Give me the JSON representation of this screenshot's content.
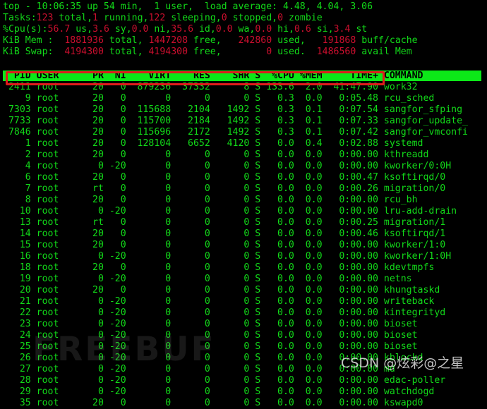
{
  "terminal": {
    "app": "top",
    "colors": {
      "background": "#000000",
      "text_green": "#12d919",
      "number_red": "#cc0f2e",
      "header_bar_green": "#0ce818",
      "header_bar_text": "#000000",
      "annotation_red": "#e01b1b"
    }
  },
  "summary": {
    "uptime_line": {
      "prefix": "top - ",
      "time": "10:06:35",
      "up_label": " up ",
      "uptime": "54 min,",
      "users": "  1 user,",
      "load_label": "  load average: ",
      "load_avg": "4.48, 4.04, 3.06",
      "full": "top - 10:06:35 up 54 min,  1 user,  load average: 4.48, 4.04, 3.06"
    },
    "tasks": {
      "label": "Tasks:",
      "total": "123",
      "total_label": " total,",
      "running": "1",
      "running_label": " running,",
      "sleeping": "122",
      "sleeping_label": " sleeping,",
      "stopped": "0",
      "stopped_label": " stopped,",
      "zombie": "0",
      "zombie_label": " zombie"
    },
    "cpu": {
      "label": "%Cpu(s):",
      "us": "56.7",
      "us_label": " us,",
      "sy": "3.6",
      "sy_label": " sy,",
      "ni": "0.0",
      "ni_label": " ni,",
      "id": "35.6",
      "id_label": " id,",
      "wa": "0.0",
      "wa_label": " wa,",
      "hi": "0.0",
      "hi_label": " hi,",
      "si": "0.6",
      "si_label": " si,",
      "st": "3.4",
      "st_label": " st"
    },
    "mem": {
      "label": "KiB Mem :",
      "total": "1881936",
      "total_label": " total,",
      "free": "1447208",
      "free_label": " free,",
      "used": "242860",
      "used_label": " used,",
      "buffcache": "191868",
      "buffcache_label": " buff/cache"
    },
    "swap": {
      "label": "KiB Swap:",
      "total": "4194300",
      "total_label": " total,",
      "free": "4194300",
      "free_label": " free,",
      "used": "0",
      "used_label": " used.",
      "avail": "1486560",
      "avail_label": " avail Mem"
    }
  },
  "table": {
    "header_text": "  PID USER      PR  NI    VIRT    RES    SHR S  %CPU %MEM     TIME+ COMMAND",
    "columns": [
      "PID",
      "USER",
      "PR",
      "NI",
      "VIRT",
      "RES",
      "SHR",
      "S",
      "%CPU",
      "%MEM",
      "TIME+",
      "COMMAND"
    ],
    "rows": [
      {
        "line": " 2411 root      20   0  879236  37332      8 S 133.6  2.0  41:47.90 work32",
        "pid": "2411",
        "user": "root",
        "pr": "20",
        "ni": "0",
        "virt": "879236",
        "res": "37332",
        "shr": "8",
        "s": "S",
        "cpu": "133.6",
        "mem": "2.0",
        "time": "41:47.90",
        "command": "work32"
      },
      {
        "line": "    9 root      20   0       0      0      0 S   0.3  0.0   0:05.48 rcu_sched",
        "pid": "9",
        "user": "root",
        "pr": "20",
        "ni": "0",
        "virt": "0",
        "res": "0",
        "shr": "0",
        "s": "S",
        "cpu": "0.3",
        "mem": "0.0",
        "time": "0:05.48",
        "command": "rcu_sched"
      },
      {
        "line": " 7303 root      20   0  115688   2104   1492 S   0.3  0.1   0:07.54 sangfor_sfping",
        "pid": "7303",
        "user": "root",
        "pr": "20",
        "ni": "0",
        "virt": "115688",
        "res": "2104",
        "shr": "1492",
        "s": "S",
        "cpu": "0.3",
        "mem": "0.1",
        "time": "0:07.54",
        "command": "sangfor_sfping"
      },
      {
        "line": " 7733 root      20   0  115700   2184   1492 S   0.3  0.1   0:07.33 sangfor_update_",
        "pid": "7733",
        "user": "root",
        "pr": "20",
        "ni": "0",
        "virt": "115700",
        "res": "2184",
        "shr": "1492",
        "s": "S",
        "cpu": "0.3",
        "mem": "0.1",
        "time": "0:07.33",
        "command": "sangfor_update_"
      },
      {
        "line": " 7846 root      20   0  115696   2172   1492 S   0.3  0.1   0:07.42 sangfor_vmconfi",
        "pid": "7846",
        "user": "root",
        "pr": "20",
        "ni": "0",
        "virt": "115696",
        "res": "2172",
        "shr": "1492",
        "s": "S",
        "cpu": "0.3",
        "mem": "0.1",
        "time": "0:07.42",
        "command": "sangfor_vmconfi"
      },
      {
        "line": "    1 root      20   0  128104   6652   4120 S   0.0  0.4   0:02.88 systemd",
        "pid": "1",
        "user": "root",
        "pr": "20",
        "ni": "0",
        "virt": "128104",
        "res": "6652",
        "shr": "4120",
        "s": "S",
        "cpu": "0.0",
        "mem": "0.4",
        "time": "0:02.88",
        "command": "systemd"
      },
      {
        "line": "    2 root      20   0       0      0      0 S   0.0  0.0   0:00.00 kthreadd",
        "pid": "2",
        "user": "root",
        "pr": "20",
        "ni": "0",
        "virt": "0",
        "res": "0",
        "shr": "0",
        "s": "S",
        "cpu": "0.0",
        "mem": "0.0",
        "time": "0:00.00",
        "command": "kthreadd"
      },
      {
        "line": "    4 root       0 -20       0      0      0 S   0.0  0.0   0:00.00 kworker/0:0H",
        "pid": "4",
        "user": "root",
        "pr": "0",
        "ni": "-20",
        "virt": "0",
        "res": "0",
        "shr": "0",
        "s": "S",
        "cpu": "0.0",
        "mem": "0.0",
        "time": "0:00.00",
        "command": "kworker/0:0H"
      },
      {
        "line": "    6 root      20   0       0      0      0 S   0.0  0.0   0:00.47 ksoftirqd/0",
        "pid": "6",
        "user": "root",
        "pr": "20",
        "ni": "0",
        "virt": "0",
        "res": "0",
        "shr": "0",
        "s": "S",
        "cpu": "0.0",
        "mem": "0.0",
        "time": "0:00.47",
        "command": "ksoftirqd/0"
      },
      {
        "line": "    7 root      rt   0       0      0      0 S   0.0  0.0   0:00.26 migration/0",
        "pid": "7",
        "user": "root",
        "pr": "rt",
        "ni": "0",
        "virt": "0",
        "res": "0",
        "shr": "0",
        "s": "S",
        "cpu": "0.0",
        "mem": "0.0",
        "time": "0:00.26",
        "command": "migration/0"
      },
      {
        "line": "    8 root      20   0       0      0      0 S   0.0  0.0   0:00.00 rcu_bh",
        "pid": "8",
        "user": "root",
        "pr": "20",
        "ni": "0",
        "virt": "0",
        "res": "0",
        "shr": "0",
        "s": "S",
        "cpu": "0.0",
        "mem": "0.0",
        "time": "0:00.00",
        "command": "rcu_bh"
      },
      {
        "line": "   10 root       0 -20       0      0      0 S   0.0  0.0   0:00.00 lru-add-drain",
        "pid": "10",
        "user": "root",
        "pr": "0",
        "ni": "-20",
        "virt": "0",
        "res": "0",
        "shr": "0",
        "s": "S",
        "cpu": "0.0",
        "mem": "0.0",
        "time": "0:00.00",
        "command": "lru-add-drain"
      },
      {
        "line": "   13 root      rt   0       0      0      0 S   0.0  0.0   0:00.25 migration/1",
        "pid": "13",
        "user": "root",
        "pr": "rt",
        "ni": "0",
        "virt": "0",
        "res": "0",
        "shr": "0",
        "s": "S",
        "cpu": "0.0",
        "mem": "0.0",
        "time": "0:00.25",
        "command": "migration/1"
      },
      {
        "line": "   14 root      20   0       0      0      0 S   0.0  0.0   0:00.46 ksoftirqd/1",
        "pid": "14",
        "user": "root",
        "pr": "20",
        "ni": "0",
        "virt": "0",
        "res": "0",
        "shr": "0",
        "s": "S",
        "cpu": "0.0",
        "mem": "0.0",
        "time": "0:00.46",
        "command": "ksoftirqd/1"
      },
      {
        "line": "   15 root      20   0       0      0      0 S   0.0  0.0   0:00.00 kworker/1:0",
        "pid": "15",
        "user": "root",
        "pr": "20",
        "ni": "0",
        "virt": "0",
        "res": "0",
        "shr": "0",
        "s": "S",
        "cpu": "0.0",
        "mem": "0.0",
        "time": "0:00.00",
        "command": "kworker/1:0"
      },
      {
        "line": "   16 root       0 -20       0      0      0 S   0.0  0.0   0:00.00 kworker/1:0H",
        "pid": "16",
        "user": "root",
        "pr": "0",
        "ni": "-20",
        "virt": "0",
        "res": "0",
        "shr": "0",
        "s": "S",
        "cpu": "0.0",
        "mem": "0.0",
        "time": "0:00.00",
        "command": "kworker/1:0H"
      },
      {
        "line": "   18 root      20   0       0      0      0 S   0.0  0.0   0:00.00 kdevtmpfs",
        "pid": "18",
        "user": "root",
        "pr": "20",
        "ni": "0",
        "virt": "0",
        "res": "0",
        "shr": "0",
        "s": "S",
        "cpu": "0.0",
        "mem": "0.0",
        "time": "0:00.00",
        "command": "kdevtmpfs"
      },
      {
        "line": "   19 root       0 -20       0      0      0 S   0.0  0.0   0:00.00 netns",
        "pid": "19",
        "user": "root",
        "pr": "0",
        "ni": "-20",
        "virt": "0",
        "res": "0",
        "shr": "0",
        "s": "S",
        "cpu": "0.0",
        "mem": "0.0",
        "time": "0:00.00",
        "command": "netns"
      },
      {
        "line": "   20 root      20   0       0      0      0 S   0.0  0.0   0:00.00 khungtaskd",
        "pid": "20",
        "user": "root",
        "pr": "20",
        "ni": "0",
        "virt": "0",
        "res": "0",
        "shr": "0",
        "s": "S",
        "cpu": "0.0",
        "mem": "0.0",
        "time": "0:00.00",
        "command": "khungtaskd"
      },
      {
        "line": "   21 root       0 -20       0      0      0 S   0.0  0.0   0:00.00 writeback",
        "pid": "21",
        "user": "root",
        "pr": "0",
        "ni": "-20",
        "virt": "0",
        "res": "0",
        "shr": "0",
        "s": "S",
        "cpu": "0.0",
        "mem": "0.0",
        "time": "0:00.00",
        "command": "writeback"
      },
      {
        "line": "   22 root       0 -20       0      0      0 S   0.0  0.0   0:00.00 kintegrityd",
        "pid": "22",
        "user": "root",
        "pr": "0",
        "ni": "-20",
        "virt": "0",
        "res": "0",
        "shr": "0",
        "s": "S",
        "cpu": "0.0",
        "mem": "0.0",
        "time": "0:00.00",
        "command": "kintegrityd"
      },
      {
        "line": "   23 root       0 -20       0      0      0 S   0.0  0.0   0:00.00 bioset",
        "pid": "23",
        "user": "root",
        "pr": "0",
        "ni": "-20",
        "virt": "0",
        "res": "0",
        "shr": "0",
        "s": "S",
        "cpu": "0.0",
        "mem": "0.0",
        "time": "0:00.00",
        "command": "bioset"
      },
      {
        "line": "   24 root       0 -20       0      0      0 S   0.0  0.0   0:00.00 bioset",
        "pid": "24",
        "user": "root",
        "pr": "0",
        "ni": "-20",
        "virt": "0",
        "res": "0",
        "shr": "0",
        "s": "S",
        "cpu": "0.0",
        "mem": "0.0",
        "time": "0:00.00",
        "command": "bioset"
      },
      {
        "line": "   25 root       0 -20       0      0      0 S   0.0  0.0   0:00.00 bioset",
        "pid": "25",
        "user": "root",
        "pr": "0",
        "ni": "-20",
        "virt": "0",
        "res": "0",
        "shr": "0",
        "s": "S",
        "cpu": "0.0",
        "mem": "0.0",
        "time": "0:00.00",
        "command": "bioset"
      },
      {
        "line": "   26 root       0 -20       0      0      0 S   0.0  0.0   0:00.00 kblockd",
        "pid": "26",
        "user": "root",
        "pr": "0",
        "ni": "-20",
        "virt": "0",
        "res": "0",
        "shr": "0",
        "s": "S",
        "cpu": "0.0",
        "mem": "0.0",
        "time": "0:00.00",
        "command": "kblockd"
      },
      {
        "line": "   27 root       0 -20       0      0      0 S   0.0  0.0   0:00.00 md",
        "pid": "27",
        "user": "root",
        "pr": "0",
        "ni": "-20",
        "virt": "0",
        "res": "0",
        "shr": "0",
        "s": "S",
        "cpu": "0.0",
        "mem": "0.0",
        "time": "0:00.00",
        "command": "md"
      },
      {
        "line": "   28 root       0 -20       0      0      0 S   0.0  0.0   0:00.00 edac-poller",
        "pid": "28",
        "user": "root",
        "pr": "0",
        "ni": "-20",
        "virt": "0",
        "res": "0",
        "shr": "0",
        "s": "S",
        "cpu": "0.0",
        "mem": "0.0",
        "time": "0:00.00",
        "command": "edac-poller"
      },
      {
        "line": "   29 root       0 -20       0      0      0 S   0.0  0.0   0:00.00 watchdogd",
        "pid": "29",
        "user": "root",
        "pr": "0",
        "ni": "-20",
        "virt": "0",
        "res": "0",
        "shr": "0",
        "s": "S",
        "cpu": "0.0",
        "mem": "0.0",
        "time": "0:00.00",
        "command": "watchdogd"
      },
      {
        "line": "   35 root      20   0       0      0      0 S   0.0  0.0   0:00.00 kswapd0",
        "pid": "35",
        "user": "root",
        "pr": "20",
        "ni": "0",
        "virt": "0",
        "res": "0",
        "shr": "0",
        "s": "S",
        "cpu": "0.0",
        "mem": "0.0",
        "time": "0:00.00",
        "command": "kswapd0"
      }
    ]
  },
  "annotation": {
    "highlight_target": "work32",
    "highlight_pid": "2411"
  },
  "watermarks": {
    "freebuf": "FREEBUF",
    "csdn": "CSDN @炫彩@之星"
  }
}
